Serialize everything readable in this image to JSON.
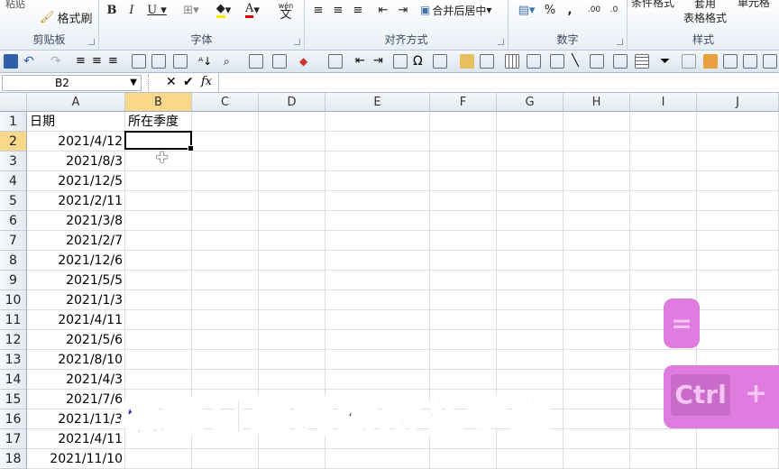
{
  "ribbon": {
    "paste_label": "粘贴",
    "format_painter_label": "格式刷",
    "wen_label": "wén",
    "wen_char": "文",
    "merge_label": "合并后居中",
    "percent": "%",
    "comma": ",",
    "cond_format_label": "条件格式",
    "table_format_label1": "套用",
    "table_format_label2": "表格格式",
    "cell_style_label": "单元格",
    "groups": {
      "clipboard": "剪贴板",
      "font": "字体",
      "alignment": "对齐方式",
      "number": "数字",
      "styles": "样式"
    }
  },
  "formula_bar": {
    "name_box": "B2",
    "cancel": "✕",
    "confirm": "✔",
    "fx": "fx",
    "value": ""
  },
  "columns": [
    "A",
    "B",
    "C",
    "D",
    "E",
    "F",
    "G",
    "H",
    "I",
    "J"
  ],
  "rows": [
    {
      "n": "1",
      "a": "日期",
      "b": "所在季度"
    },
    {
      "n": "2",
      "a": "2021/4/12",
      "b": ""
    },
    {
      "n": "3",
      "a": "2021/8/3",
      "b": ""
    },
    {
      "n": "4",
      "a": "2021/12/5",
      "b": ""
    },
    {
      "n": "5",
      "a": "2021/2/11",
      "b": ""
    },
    {
      "n": "6",
      "a": "2021/3/8",
      "b": ""
    },
    {
      "n": "7",
      "a": "2021/2/7",
      "b": ""
    },
    {
      "n": "8",
      "a": "2021/12/6",
      "b": ""
    },
    {
      "n": "9",
      "a": "2021/5/5",
      "b": ""
    },
    {
      "n": "10",
      "a": "2021/1/3",
      "b": ""
    },
    {
      "n": "11",
      "a": "2021/4/11",
      "b": ""
    },
    {
      "n": "12",
      "a": "2021/5/6",
      "b": ""
    },
    {
      "n": "13",
      "a": "2021/8/10",
      "b": ""
    },
    {
      "n": "14",
      "a": "2021/4/3",
      "b": ""
    },
    {
      "n": "15",
      "a": "2021/7/6",
      "b": ""
    },
    {
      "n": "16",
      "a": "2021/11/3",
      "b": ""
    },
    {
      "n": "17",
      "a": "2021/4/11",
      "b": ""
    },
    {
      "n": "18",
      "a": "2021/11/10",
      "b": ""
    }
  ],
  "overlay": {
    "caption": "根据日期判断所在季度",
    "key_equals": "=",
    "key_ctrl": "Ctrl",
    "key_plus": "+"
  },
  "colors": {
    "selected_header": "#f9d889",
    "caption": "#1a1aa8",
    "key_bg": "#e07be0"
  }
}
